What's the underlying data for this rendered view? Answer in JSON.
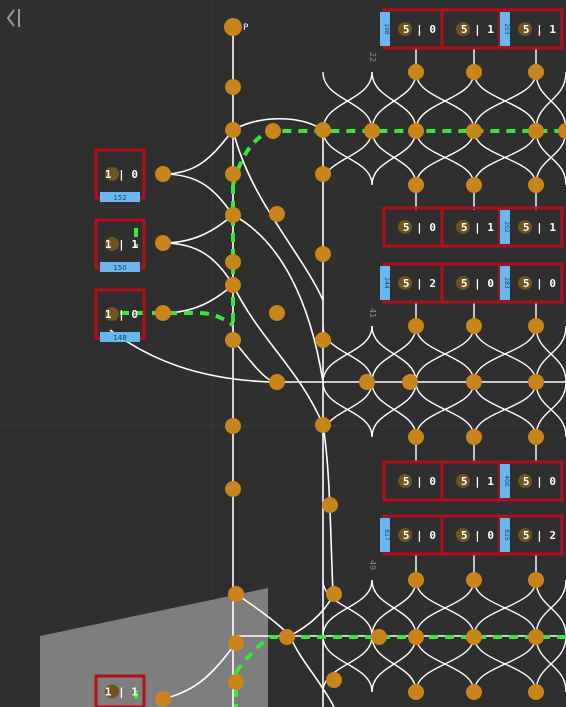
{
  "view": {
    "title": "parking-lot-graph-editor",
    "colors": {
      "background": "#2f2f2f",
      "grid": "#3a3a3a",
      "path": "#ffffff",
      "highlight": "#39e639",
      "node": "#c8861a",
      "spot_border": "#b0101c",
      "spot_tag": "#6ab7f0"
    }
  },
  "toolbar": {
    "collapse_icon": "collapse-left-icon"
  },
  "start_marker": {
    "label": "P"
  },
  "left_spots": [
    {
      "tag": "152",
      "status": "1 | 0"
    },
    {
      "tag": "150",
      "status": "1 | 1"
    },
    {
      "tag": "148",
      "status": "1 | 0"
    }
  ],
  "bottom_left_spot": {
    "status": "1 | 1"
  },
  "grid_spots": [
    {
      "tag": "198",
      "status": "5 | 0"
    },
    {
      "tag": "",
      "status": "5 | 1"
    },
    {
      "tag": "203",
      "status": "5 | 1"
    },
    {
      "tag": "",
      "status": "5 | 0"
    },
    {
      "tag": "",
      "status": "5 | 1"
    },
    {
      "tag": "202",
      "status": "5 | 1"
    },
    {
      "tag": "244",
      "status": "5 | 2"
    },
    {
      "tag": "",
      "status": "5 | 0"
    },
    {
      "tag": "283",
      "status": "5 | 0"
    },
    {
      "tag": "",
      "status": "5 | 0"
    },
    {
      "tag": "",
      "status": "5 | 1"
    },
    {
      "tag": "400",
      "status": "5 | 0"
    },
    {
      "tag": "817",
      "status": "5 | 0"
    },
    {
      "tag": "",
      "status": "5 | 0"
    },
    {
      "tag": "815",
      "status": "5 | 2"
    }
  ],
  "row_labels": [
    "22",
    "41",
    "49"
  ]
}
